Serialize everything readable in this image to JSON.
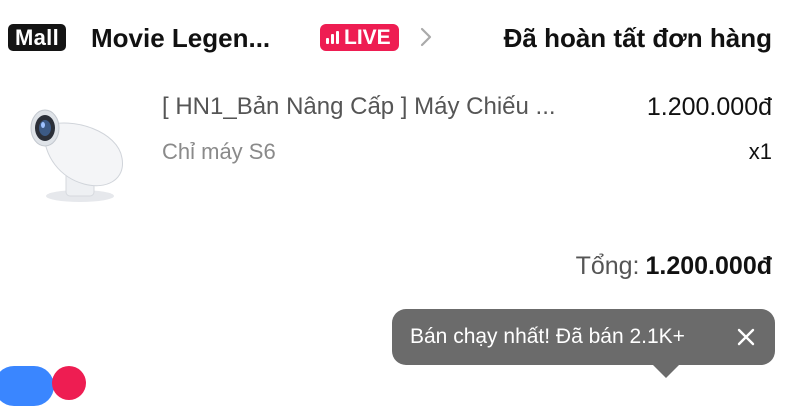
{
  "header": {
    "mall_badge": "Mall",
    "shop_name": "Movie Legen...",
    "live_badge": "LIVE",
    "order_status": "Đã hoàn tất đơn hàng"
  },
  "product": {
    "title": "[ HN1_Bản Nâng Cấp ] Máy Chiếu ...",
    "price": "1.200.000đ",
    "variant": "Chỉ máy S6",
    "quantity": "x1"
  },
  "summary": {
    "total_label": "Tổng:",
    "total_value": "1.200.000đ"
  },
  "tooltip": {
    "text": "Bán chạy nhất! Đã bán 2.1K+"
  },
  "colors": {
    "accent_live": "#ee1d52",
    "mall_badge_bg": "#141414",
    "tooltip_bg": "#6b6b6b"
  },
  "icons": {
    "live": "bar-chart-icon",
    "chevron": "chevron-right-icon",
    "close": "close-icon"
  }
}
